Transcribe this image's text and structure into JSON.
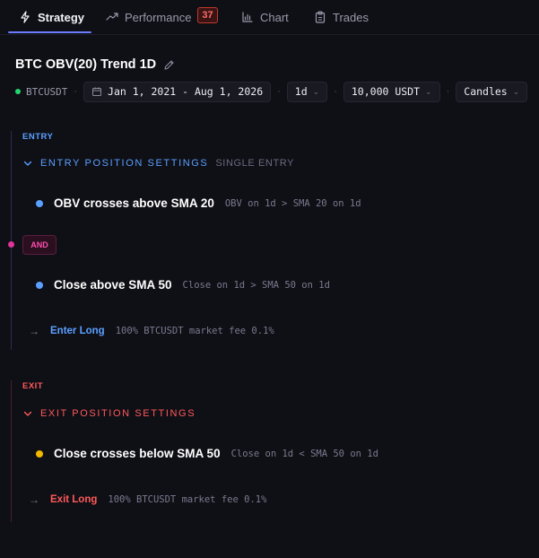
{
  "tabs": [
    {
      "label": "Strategy",
      "icon": "bolt-icon",
      "active": true
    },
    {
      "label": "Performance",
      "icon": "trend-icon",
      "badge": "37"
    },
    {
      "label": "Chart",
      "icon": "chart-icon"
    },
    {
      "label": "Trades",
      "icon": "clipboard-icon"
    }
  ],
  "strategy": {
    "title": "BTC OBV(20) Trend 1D",
    "symbol": "BTCUSDT",
    "separator": "·",
    "date_range": "Jan 1, 2021 - Aug 1, 2026",
    "timeframe": "1d",
    "capital": "10,000 USDT",
    "view": "Candles"
  },
  "entry": {
    "label": "ENTRY",
    "settings_title": "ENTRY POSITION SETTINGS",
    "settings_sub": "SINGLE ENTRY",
    "conditions": [
      {
        "title": "OBV crosses above SMA 20",
        "desc": "OBV on 1d > SMA 20 on 1d"
      },
      {
        "title": "Close above SMA 50",
        "desc": "Close on 1d > SMA 50 on 1d"
      }
    ],
    "join": "AND",
    "action_label": "Enter Long",
    "action_desc": "100% BTCUSDT market fee 0.1%"
  },
  "exit": {
    "label": "EXIT",
    "settings_title": "EXIT POSITION SETTINGS",
    "conditions": [
      {
        "title": "Close crosses below SMA 50",
        "desc": "Close on 1d < SMA 50 on 1d"
      }
    ],
    "action_label": "Exit Long",
    "action_desc": "100% BTCUSDT market fee 0.1%"
  },
  "colors": {
    "accent_blue": "#5aa0ff",
    "accent_red": "#ff5a5a",
    "and_pink": "#ff4fb0",
    "status_green": "#22d66b",
    "bullet_yellow": "#f5b800"
  }
}
